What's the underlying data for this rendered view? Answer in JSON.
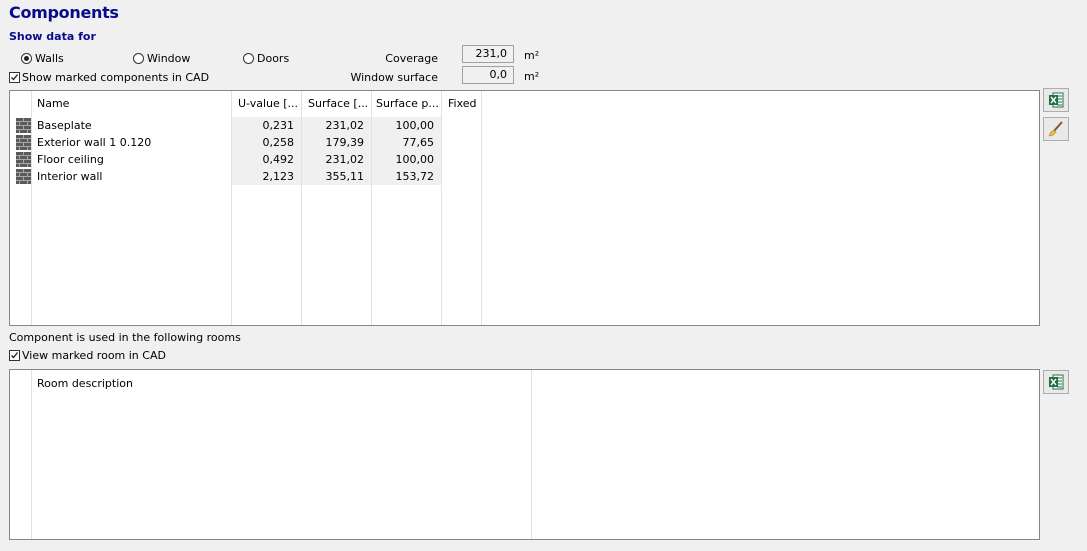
{
  "page": {
    "title": "Components",
    "show_data_for": "Show data for"
  },
  "filters": {
    "radios": [
      {
        "label": "Walls",
        "selected": true
      },
      {
        "label": "Window",
        "selected": false
      },
      {
        "label": "Doors",
        "selected": false
      }
    ],
    "show_marked_components": {
      "label": "Show marked components in CAD",
      "checked": true
    }
  },
  "summary": {
    "coverage_label": "Coverage",
    "coverage_value": "231,0",
    "coverage_unit": "m²",
    "window_surface_label": "Window surface",
    "window_surface_value": "0,0",
    "window_surface_unit": "m²"
  },
  "components_table": {
    "headers": [
      "Name",
      "U-value [...",
      "Surface [...",
      "Surface p...",
      "Fixed"
    ],
    "rows": [
      {
        "icon": "brick-wall-icon",
        "name": "Baseplate",
        "u_value": "0,231",
        "surface": "231,02",
        "surface_p": "100,00",
        "fixed": ""
      },
      {
        "icon": "brick-wall-icon",
        "name": "Exterior wall 1 0.120",
        "u_value": "0,258",
        "surface": "179,39",
        "surface_p": "77,65",
        "fixed": ""
      },
      {
        "icon": "brick-wall-icon",
        "name": "Floor ceiling",
        "u_value": "0,492",
        "surface": "231,02",
        "surface_p": "100,00",
        "fixed": ""
      },
      {
        "icon": "brick-wall-icon",
        "name": "Interior wall",
        "u_value": "2,123",
        "surface": "355,11",
        "surface_p": "153,72",
        "fixed": ""
      }
    ]
  },
  "rooms_section": {
    "caption": "Component is used in the following rooms",
    "view_marked_room": {
      "label": "View marked room in CAD",
      "checked": true
    },
    "headers": [
      "Room description"
    ]
  },
  "side_buttons": {
    "export_excel_icon": "excel-icon",
    "edit_icon": "brush-icon"
  },
  "colors": {
    "title": "#0a0a8c",
    "excel_green": "#1f7244"
  }
}
